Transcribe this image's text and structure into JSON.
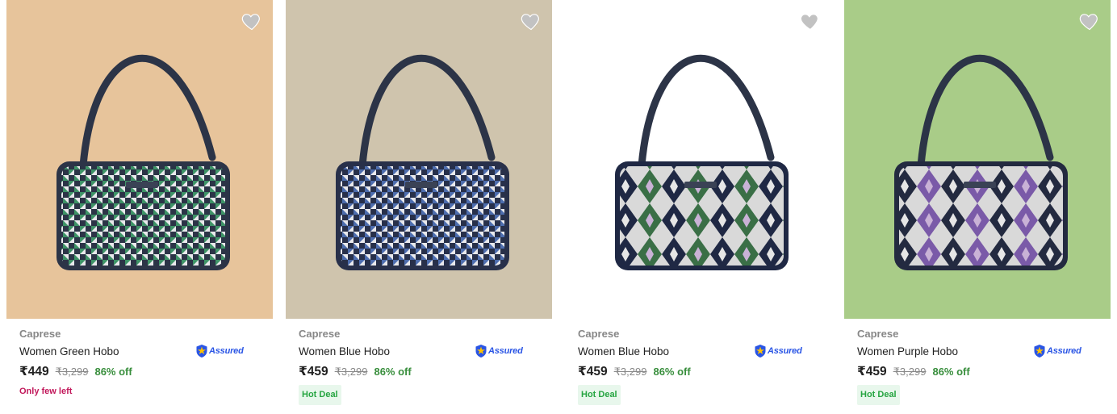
{
  "products": [
    {
      "brand": "Caprese",
      "title": "Women Green Hobo",
      "assured": "Assured",
      "price": "₹449",
      "mrp": "₹3,299",
      "discount": "86% off",
      "tag": "Only few left",
      "tag_type": "stock",
      "image_icon": "handbag-image",
      "pattern": "houndstooth",
      "colors": {
        "bg": "#e7c49b",
        "accent": "#2b8a59",
        "dark": "#2c3447"
      }
    },
    {
      "brand": "Caprese",
      "title": "Women Blue Hobo",
      "assured": "Assured",
      "price": "₹459",
      "mrp": "₹3,299",
      "discount": "86% off",
      "tag": "Hot Deal",
      "tag_type": "deal",
      "image_icon": "handbag-image",
      "pattern": "houndstooth",
      "colors": {
        "bg": "#cfc4ad",
        "accent": "#3c5fa8",
        "dark": "#28304a"
      }
    },
    {
      "brand": "Caprese",
      "title": "Women Blue Hobo",
      "assured": "Assured",
      "price": "₹459",
      "mrp": "₹3,299",
      "discount": "86% off",
      "tag": "Hot Deal",
      "tag_type": "deal",
      "image_icon": "handbag-image",
      "pattern": "aztec",
      "colors": {
        "bg": "#ffffff",
        "accent": "#3a6f46",
        "dark": "#1f2844"
      }
    },
    {
      "brand": "Caprese",
      "title": "Women Purple Hobo",
      "assured": "Assured",
      "price": "₹459",
      "mrp": "₹3,299",
      "discount": "86% off",
      "tag": "Hot Deal",
      "tag_type": "deal",
      "image_icon": "handbag-image",
      "pattern": "aztec",
      "colors": {
        "bg": "#a9cc88",
        "accent": "#7a5aa8",
        "dark": "#232a40"
      }
    }
  ],
  "colors": {
    "assured_blue": "#2a55e5",
    "discount_green": "#388e3c",
    "few_left": "#c2185b",
    "deal_bg": "#e8f7ec",
    "deal_text": "#26a541"
  }
}
